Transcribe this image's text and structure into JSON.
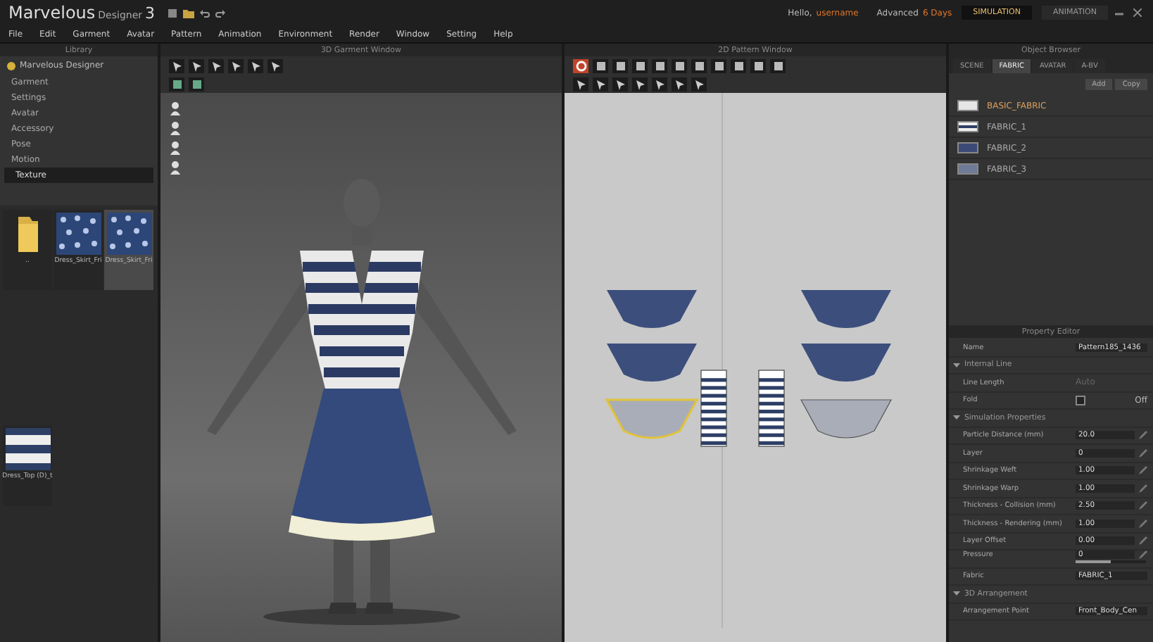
{
  "app": {
    "logo": "Marvelous",
    "logo_sub": "Designer",
    "logo_version": "3"
  },
  "menu": [
    "File",
    "Edit",
    "Garment",
    "Avatar",
    "Pattern",
    "Animation",
    "Environment",
    "Render",
    "Window",
    "Setting",
    "Help"
  ],
  "account": {
    "greeting": "Hello,",
    "user": "username",
    "mode_label": "Advanced",
    "mode_value": "6 Days"
  },
  "modes": [
    {
      "label": "SIMULATION",
      "selected": true
    },
    {
      "label": "ANIMATION",
      "selected": false
    }
  ],
  "library": {
    "title": "Library",
    "root": "Marvelous Designer",
    "items": [
      {
        "label": "Garment",
        "selected": false
      },
      {
        "label": "Settings",
        "selected": false
      },
      {
        "label": "Avatar",
        "selected": false
      },
      {
        "label": "Accessory",
        "selected": false
      },
      {
        "label": "Pose",
        "selected": false
      },
      {
        "label": "Motion",
        "selected": false
      },
      {
        "label": "Texture",
        "selected": true
      }
    ],
    "files": [
      {
        "kind": "folder",
        "label": "..",
        "selected": false
      },
      {
        "kind": "print",
        "label": "Dress_Skirt_Fri",
        "selected": false
      },
      {
        "kind": "print",
        "label": "Dress_Skirt_Fri",
        "selected": true
      },
      {
        "kind": "stripe",
        "label": "Dress_Top (D)_t",
        "selected": false
      }
    ]
  },
  "viewport3d": {
    "title": "3D Garment Window"
  },
  "viewport2d": {
    "title": "2D Pattern Window"
  },
  "object_browser": {
    "title": "Object Browser",
    "tabs": [
      {
        "label": "SCENE",
        "selected": false
      },
      {
        "label": "FABRIC",
        "selected": true
      },
      {
        "label": "AVATAR",
        "selected": false
      },
      {
        "label": "A-BV",
        "selected": false
      }
    ],
    "buttons": [
      "Add",
      "Copy"
    ],
    "fabrics": [
      {
        "name": "BASIC_FABRIC",
        "kind": "plain",
        "color": "#e6e6e6",
        "selected": true
      },
      {
        "name": "FABRIC_1",
        "kind": "stripe",
        "color": "#2e3f66",
        "selected": false
      },
      {
        "name": "FABRIC_2",
        "kind": "plain",
        "color": "#3c4a78",
        "selected": false
      },
      {
        "name": "FABRIC_3",
        "kind": "plain",
        "color": "#6e7a98",
        "selected": false
      }
    ]
  },
  "property_editor": {
    "title": "Property Editor",
    "rows": [
      {
        "kind": "field",
        "label": "Name",
        "value": "Pattern185_1436",
        "edit": false
      },
      {
        "kind": "group",
        "label": "Internal Line",
        "expanded": true
      },
      {
        "kind": "disabled",
        "label": "Line Length",
        "value": "Auto"
      },
      {
        "kind": "check",
        "label": "Fold",
        "value": "Off",
        "checked": false
      },
      {
        "kind": "group",
        "label": "Simulation Properties",
        "expanded": true
      },
      {
        "kind": "field",
        "label": "Particle Distance (mm)",
        "value": "20.0",
        "edit": true
      },
      {
        "kind": "field",
        "label": "Layer",
        "value": "0",
        "edit": true
      },
      {
        "kind": "field",
        "label": "Shrinkage Weft",
        "value": "1.00",
        "edit": true
      },
      {
        "kind": "field",
        "label": "Shrinkage Warp",
        "value": "1.00",
        "edit": true
      },
      {
        "kind": "field",
        "label": "Thickness - Collision (mm)",
        "value": "2.50",
        "edit": true
      },
      {
        "kind": "field",
        "label": "Thickness - Rendering (mm)",
        "value": "1.00",
        "edit": true
      },
      {
        "kind": "field",
        "label": "Layer Offset",
        "value": "0.00",
        "edit": true
      },
      {
        "kind": "slider",
        "label": "Pressure",
        "value": "0",
        "level": 0.5
      },
      {
        "kind": "field",
        "label": "Fabric",
        "value": "FABRIC_1",
        "edit": false
      },
      {
        "kind": "group",
        "label": "3D Arrangement",
        "expanded": true
      },
      {
        "kind": "field",
        "label": "Arrangement Point",
        "value": "Front_Body_Cen",
        "edit": false
      }
    ]
  }
}
